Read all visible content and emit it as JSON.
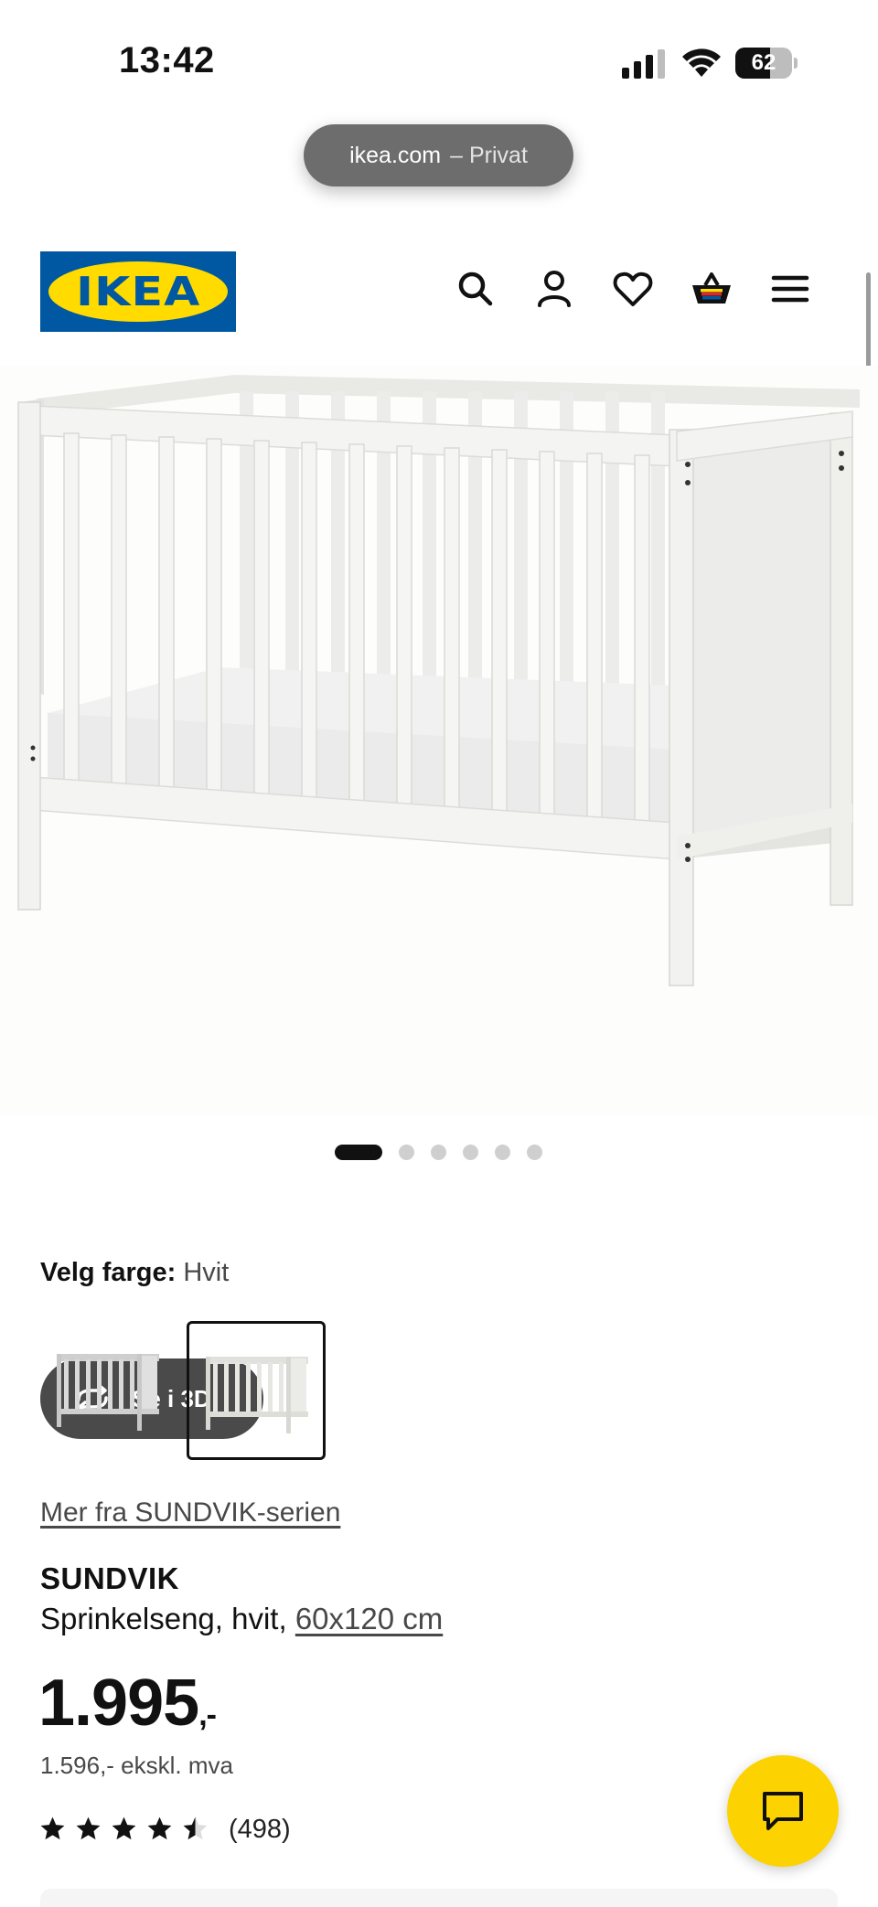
{
  "status_bar": {
    "time": "13:42",
    "battery": "62",
    "battery_level_percent": 62,
    "icons": [
      "cellular-signal-icon",
      "wifi-icon",
      "battery-icon"
    ]
  },
  "browser": {
    "domain": "ikea.com",
    "mode": "– Privat"
  },
  "header": {
    "logo_text": "IKEA",
    "icons": [
      "search-icon",
      "account-icon",
      "heart-icon",
      "shopping-bag-icon",
      "menu-icon"
    ]
  },
  "gallery": {
    "see_3d_label": "Se i 3D",
    "total_images": 6,
    "active_image": 1
  },
  "color_picker": {
    "label": "Velg farge:",
    "selected": "Hvit",
    "options_count": 2,
    "selected_index": 2
  },
  "product": {
    "series_link": "Mer fra SUNDVIK-serien",
    "name": "SUNDVIK",
    "description": "Sprinkelseng, hvit,",
    "size": "60x120 cm",
    "price": "1.995",
    "price_suffix": ",-",
    "price_ex_vat": "1.596,- ekskl. mva",
    "rating": 4.5,
    "rating_max": 5,
    "review_count": "(498)"
  },
  "colors": {
    "brand_blue": "#0058a3",
    "brand_yellow": "#ffdb00",
    "chat_yellow": "#fcd200",
    "see3d_bg": "#4a4a4a"
  }
}
